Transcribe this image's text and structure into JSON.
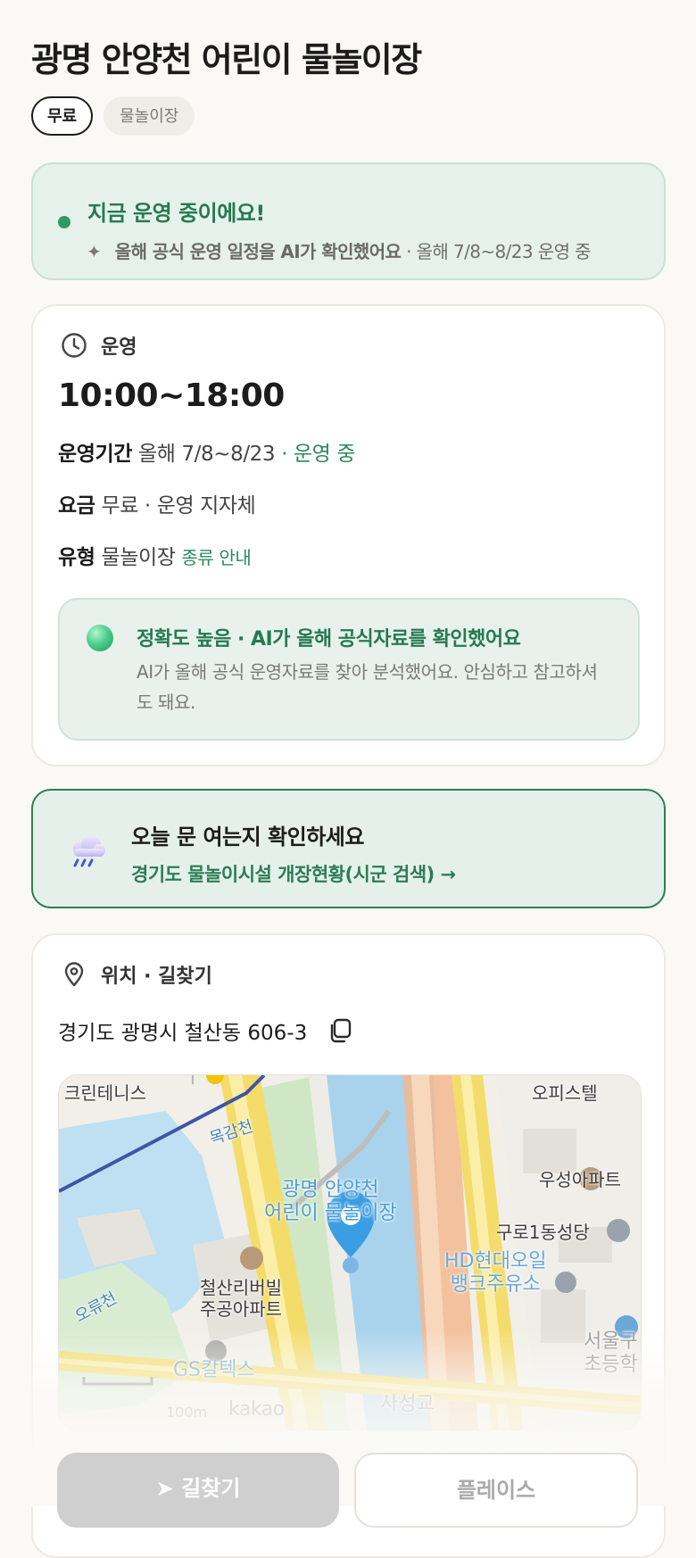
{
  "page": {
    "title": "광명 안양천 어린이 물놀이장",
    "tags": [
      "무료",
      "물놀이장"
    ]
  },
  "status": {
    "title": "지금 운영 중이에요!",
    "ai_note": "올해 공식 운영 일정을 AI가 확인했어요",
    "period_note": "· 올해 7/8~8/23 운영 중"
  },
  "hours": {
    "section_label": "운영",
    "time": "10:00~18:00",
    "period_label": "운영기간",
    "period_value": "올해 7/8~8/23",
    "period_status": "· 운영 중",
    "fee_label": "요금",
    "fee_value": "무료 · 운영 지자체",
    "type_label": "유형",
    "type_value": "물놀이장",
    "type_link": "종류 안내",
    "accuracy_title": "정확도 높음 · AI가 올해 공식자료를 확인했어요",
    "accuracy_desc": "AI가 올해 공식 운영자료를 찾아 분석했어요. 안심하고 참고하셔도 돼요."
  },
  "notice": {
    "title": "오늘 문 여는지 확인하세요",
    "link": "경기도 물놀이시설 개장현황(시군 검색) →"
  },
  "location": {
    "section_label": "위치 · 길찾기",
    "address": "경기도 광명시 철산동 606-3",
    "map_labels": {
      "tennis": "크린테니스",
      "officetel": "오피스텔",
      "stream": "목감천",
      "place": "광명 안양천\n어린이 물놀이장",
      "apt1": "우성아파트",
      "church": "구로1동성당",
      "gas1": "HD현대오일\n뱅크주유소",
      "apt2": "철산리버빌\n주공아파트",
      "stream2": "오류천",
      "gas2": "GS칼텍스",
      "school": "서울구\n초등학",
      "bridge": "사성교",
      "scale": "100m",
      "provider": "kakao"
    },
    "buttons": {
      "directions": "길찾기",
      "place": "플레이스"
    }
  }
}
